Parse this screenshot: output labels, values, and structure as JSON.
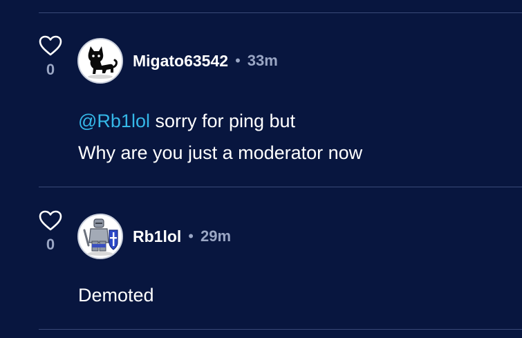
{
  "comments": [
    {
      "username": "Migato63542",
      "separator": "•",
      "time": "33m",
      "like_count": "0",
      "mention": "@Rb1lol",
      "line1_rest": " sorry for ping but",
      "line2": "Why are you just a moderator now",
      "avatar_icon": "black-cat-avatar-icon",
      "heart_icon": "heart-outline-icon"
    },
    {
      "username": "Rb1lol",
      "separator": "•",
      "time": "29m",
      "like_count": "0",
      "text": "Demoted",
      "avatar_icon": "knight-avatar-icon",
      "heart_icon": "heart-outline-icon"
    }
  ],
  "colors": {
    "background": "#08163f",
    "mention": "#35b8e8",
    "muted": "#9aa6c4",
    "divider": "#3a4a78"
  }
}
